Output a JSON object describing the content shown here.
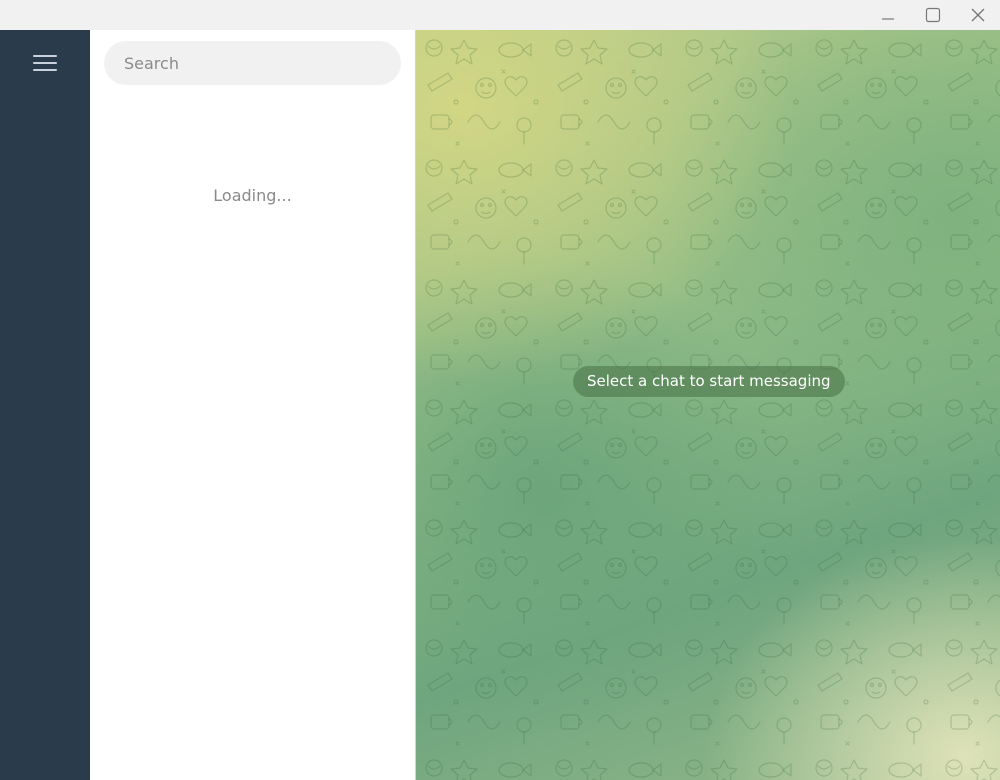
{
  "window": {
    "controls": [
      {
        "name": "minimize",
        "icon": "minimize-icon"
      },
      {
        "name": "maximize",
        "icon": "maximize-icon"
      },
      {
        "name": "close",
        "icon": "close-icon"
      }
    ]
  },
  "sidebar": {
    "menu_icon": "hamburger-menu-icon"
  },
  "chatlist": {
    "search": {
      "placeholder": "Search",
      "value": ""
    },
    "status_text": "Loading..."
  },
  "chat_area": {
    "empty_message": "Select a chat to start messaging"
  },
  "colors": {
    "sidebar_bg": "#2a3b4c",
    "titlebar_bg": "#f1f1f1",
    "chat_bg_yellow": "#d1d684",
    "chat_bg_green": "#6da57b",
    "pill_bg": "#4e784a"
  }
}
